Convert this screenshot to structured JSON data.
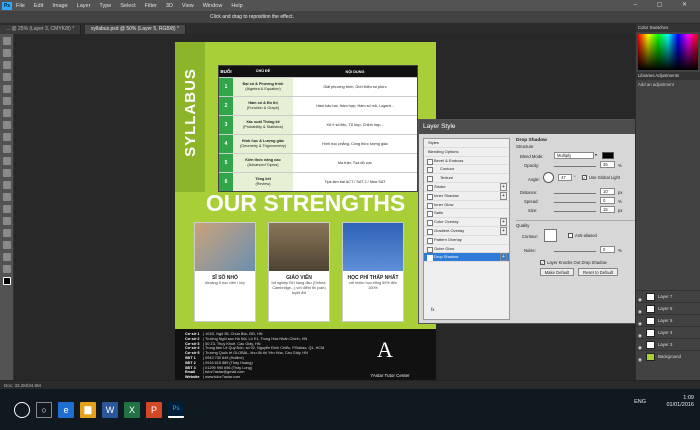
{
  "menu": {
    "app_logo": "Ps",
    "items": [
      "File",
      "Edit",
      "Image",
      "Layer",
      "Type",
      "Select",
      "Filter",
      "3D",
      "View",
      "Window",
      "Help"
    ]
  },
  "options_hint": "Click and drag to reposition the effect.",
  "tabs": [
    {
      "label": "... @ 25% (Layer 3, CMYK/8) *",
      "active": false
    },
    {
      "label": "syllabus.psd @ 50% (Layer 5, RGB/8) *",
      "active": true
    }
  ],
  "document": {
    "syllabus": "SYLLABUS",
    "table": {
      "headers": [
        "BUỔI",
        "CHỦ ĐỀ",
        "NỘI DUNG"
      ],
      "rows": [
        {
          "num": "1",
          "topic": "Đại số & Phương trình",
          "topic_en": "(Algebra & Equation)",
          "content": "Giải phương trình, Giới thiệu số phức"
        },
        {
          "num": "2",
          "topic": "Hàm số & Đồ thị",
          "topic_en": "(Function & Graph)",
          "content": "Hàm bậc hai, Hàm hợp, Hàm số mũ, Logarit..."
        },
        {
          "num": "3",
          "topic": "Xác suất Thống kê",
          "topic_en": "(Probability & Statistics)",
          "content": "Xử lí số liệu, Tổ hợp, Chỉnh hợp..."
        },
        {
          "num": "4",
          "topic": "Hình học & Lượng giác",
          "topic_en": "(Geometry & Trigonometry)",
          "content": "Hình học phẳng, Công thức lượng giác"
        },
        {
          "num": "5",
          "topic": "Kiến thức nâng cao",
          "topic_en": "(Advanced Topics)",
          "content": "Ma trận, Tọa độ cực"
        },
        {
          "num": "6",
          "topic": "Tổng kết",
          "topic_en": "(Review)",
          "content": "Tips làm bài ACT / SAT 2 / New SAT"
        }
      ]
    },
    "strengths": "OUR STRENGTHS",
    "cards": [
      {
        "title": "SĨ SỐ NHỎ",
        "sub": "khoảng 5 học viên / lớp"
      },
      {
        "title": "GIÁO VIÊN",
        "sub": "tốt nghiệp ĐH hàng đầu (Oxford, Cambridge...) với điểm thi (cán) tuyệt đối"
      },
      {
        "title": "HỌC PHÍ THẤP NHẤT",
        "sub": "với nhiều học bổng 50% đến 100%"
      }
    ],
    "contact": [
      {
        "label": "Cơ sở 1",
        "value": "101D, Ngõ 95, Chùa Bộc, ĐĐ, HN"
      },
      {
        "label": "Cơ sở 2",
        "value": "Trường Ngôi sao Hà Nội, Lô E1, Trung Hòa Nhân Chính, HN"
      },
      {
        "label": "Cơ sở 3",
        "value": "50 Z3, Thụy Khuê, Cầu Giấy, HN"
      },
      {
        "label": "Cơ sở 4",
        "value": "Trung tâm Lê Quý Đôn, số 92, Nguyễn Đình Chiểu, P.Đakao, Q1, HCM"
      },
      {
        "label": "Cơ sở 5",
        "value": "Trường Quốc tế GLOBAL, khu đô thị Yên Hòa, Cầu Giấy, HN"
      },
      {
        "label": "SĐT 1",
        "value": "0943 700 849 (Hotline)"
      },
      {
        "label": "SĐT 2",
        "value": "0916 615 889 (Thầy Hoàng)"
      },
      {
        "label": "SĐT 3",
        "value": "01299 990 696 (Thầy Long)"
      },
      {
        "label": "Email",
        "value": "tutor7astar@gmail.com"
      },
      {
        "label": "Website",
        "value": "www.tutor7astar.com"
      },
      {
        "label": "Fanpage",
        "value": "facebook.com/7astar"
      },
      {
        "label": "Youtube",
        "value": "www.youtube.com/user/vietnungtran85"
      }
    ],
    "logo_letter": "A",
    "logo_text": "7Astar Tutor Center"
  },
  "dialog": {
    "title": "Layer Style",
    "list": [
      {
        "label": "Styles",
        "cb": false,
        "plus": false,
        "sel": false
      },
      {
        "label": "Blending Options",
        "cb": false,
        "plus": false,
        "sel": false
      },
      {
        "label": "Bevel & Emboss",
        "cb": true,
        "plus": false,
        "sel": false
      },
      {
        "label": "Contour",
        "cb": true,
        "plus": false,
        "sel": false
      },
      {
        "label": "Texture",
        "cb": true,
        "plus": false,
        "sel": false
      },
      {
        "label": "Stroke",
        "cb": true,
        "plus": true,
        "sel": false
      },
      {
        "label": "Inner Shadow",
        "cb": true,
        "plus": true,
        "sel": false
      },
      {
        "label": "Inner Glow",
        "cb": true,
        "plus": false,
        "sel": false
      },
      {
        "label": "Satin",
        "cb": true,
        "plus": false,
        "sel": false
      },
      {
        "label": "Color Overlay",
        "cb": true,
        "plus": true,
        "sel": false
      },
      {
        "label": "Gradient Overlay",
        "cb": true,
        "plus": true,
        "sel": false
      },
      {
        "label": "Pattern Overlay",
        "cb": true,
        "plus": false,
        "sel": false
      },
      {
        "label": "Outer Glow",
        "cb": true,
        "plus": false,
        "sel": false
      },
      {
        "label": "Drop Shadow",
        "cb": true,
        "plus": true,
        "sel": true
      }
    ],
    "fx": "fx",
    "section": "Drop Shadow",
    "structure": "Structure",
    "blend_mode_label": "Blend Mode:",
    "blend_mode": "Multiply",
    "opacity_label": "Opacity:",
    "opacity": "35",
    "angle_label": "Angle:",
    "angle": "47",
    "global_light": "Use Global Light",
    "distance_label": "Distance:",
    "distance": "10",
    "spread_label": "Spread:",
    "spread": "0",
    "size_label": "Size:",
    "size": "15",
    "unit_pct": "%",
    "unit_px": "px",
    "unit_deg": "°",
    "quality": "Quality",
    "contour_label": "Contour:",
    "anti_aliased": "Anti-aliased",
    "noise_label": "Noise:",
    "noise": "0",
    "knockout": "Layer Knocks Out Drop Shadow",
    "make_default": "Make Default",
    "reset_default": "Reset to Default",
    "shadow_color": "#000000"
  },
  "right_panel": {
    "color_tabs": "Color   Swatches",
    "adjust_tabs": "Libraries   Adjustments",
    "adjust_hint": "Add an adjustment",
    "layers": [
      {
        "name": "Layer 7",
        "bg": false
      },
      {
        "name": "Layer 6",
        "bg": false
      },
      {
        "name": "Layer 5",
        "bg": false
      },
      {
        "name": "Layer 4",
        "bg": false
      },
      {
        "name": "Layer 3",
        "bg": false
      },
      {
        "name": "Background",
        "bg": true
      }
    ]
  },
  "status": "Doc: 33.2M/34.9M",
  "taskbar": {
    "apps": [
      {
        "icon": "○",
        "color": "#ffffff00"
      },
      {
        "icon": "e",
        "color": "#1e6fd0"
      },
      {
        "icon": "▆",
        "color": "#e3a21a"
      },
      {
        "icon": "W",
        "color": "#2b579a"
      },
      {
        "icon": "X",
        "color": "#217346"
      },
      {
        "icon": "P",
        "color": "#d24726"
      },
      {
        "icon": "Ps",
        "color": "#001e36"
      }
    ],
    "lang": "ENG",
    "time": "1:09",
    "date": "01/01/2016"
  }
}
